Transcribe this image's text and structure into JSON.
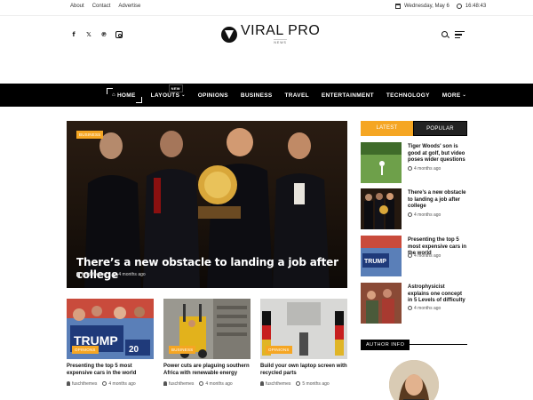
{
  "topbar": {
    "links": [
      "About",
      "Contact",
      "Advertise"
    ],
    "date": "Wednesday, May 6",
    "time": "16:48:43"
  },
  "header": {
    "logo_title": "VIRAL PRO",
    "logo_sub": "NEWS",
    "social_icons": [
      "facebook-icon",
      "twitter-icon",
      "pinterest-icon",
      "instagram-icon"
    ]
  },
  "nav": {
    "items": [
      {
        "label": "HOME",
        "icon": "home-icon"
      },
      {
        "label": "LAYOUTS",
        "badge": "NEW",
        "dropdown": true
      },
      {
        "label": "OPINIONS"
      },
      {
        "label": "BUSINESS"
      },
      {
        "label": "TRAVEL"
      },
      {
        "label": "ENTERTAINMENT"
      },
      {
        "label": "TECHNOLOGY"
      },
      {
        "label": "MORE",
        "dropdown": true
      }
    ]
  },
  "hero": {
    "category": "BUSINESS",
    "title": "There’s a new obstacle to landing a job after college",
    "author": "fuschthemes",
    "date": "4 months ago"
  },
  "cards": [
    {
      "category": "OPINIONS",
      "title": "Presenting the top 5 most expensive cars in the world",
      "author": "fuschthemes",
      "date": "4 months ago"
    },
    {
      "category": "BUSINESS",
      "title": "Power cuts are plaguing southern Africa with renewable energy",
      "author": "fuschthemes",
      "date": "4 months ago"
    },
    {
      "category": "OPINIONS",
      "title": "Build your own laptop screen with recycled parts",
      "author": "fuschthemes",
      "date": "5 months ago"
    }
  ],
  "sidebar": {
    "tabs": [
      "LATEST",
      "POPULAR"
    ],
    "items": [
      {
        "title": "Tiger Woods' son is good at golf, but video poses wider questions",
        "date": "4 months ago"
      },
      {
        "title": "There’s a new obstacle to landing a job after college",
        "date": "4 months ago"
      },
      {
        "title": "Presenting the top 5 most expensive cars in the world",
        "date": "4 months ago"
      },
      {
        "title": "Astrophysicist explains one concept in 5 Levels of difficulty",
        "date": "4 months ago"
      }
    ],
    "author_info_label": "AUTHOR INFO"
  },
  "colors": {
    "accent": "#f5a623",
    "nav_bg": "#000000"
  }
}
